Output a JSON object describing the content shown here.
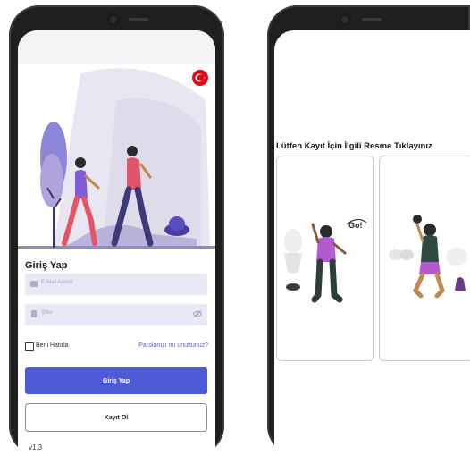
{
  "login_screen": {
    "flag_icon": "turkey-flag-icon",
    "title": "Giriş Yap",
    "email_placeholder": "E-Mail Adresi",
    "password_placeholder": "Şifre",
    "remember_me": "Beni Hatırla",
    "forgot_password": "Parolanızı mı unuttunuz?",
    "login_button": "Giriş Yap",
    "register_button": "Kayıt Ol",
    "version": "v1.3",
    "colors": {
      "primary": "#4e5bd6",
      "field_bg": "#e7eaf6",
      "flag_red": "#e30a17"
    }
  },
  "selection_screen": {
    "heading": "Lütfen Kayıt İçin İlgili Resme Tıklayınız",
    "illustration_text": "Go!",
    "cards": [
      {
        "icon": "coach-cheering-illustration"
      },
      {
        "icon": "athlete-kettlebell-illustration"
      }
    ]
  }
}
